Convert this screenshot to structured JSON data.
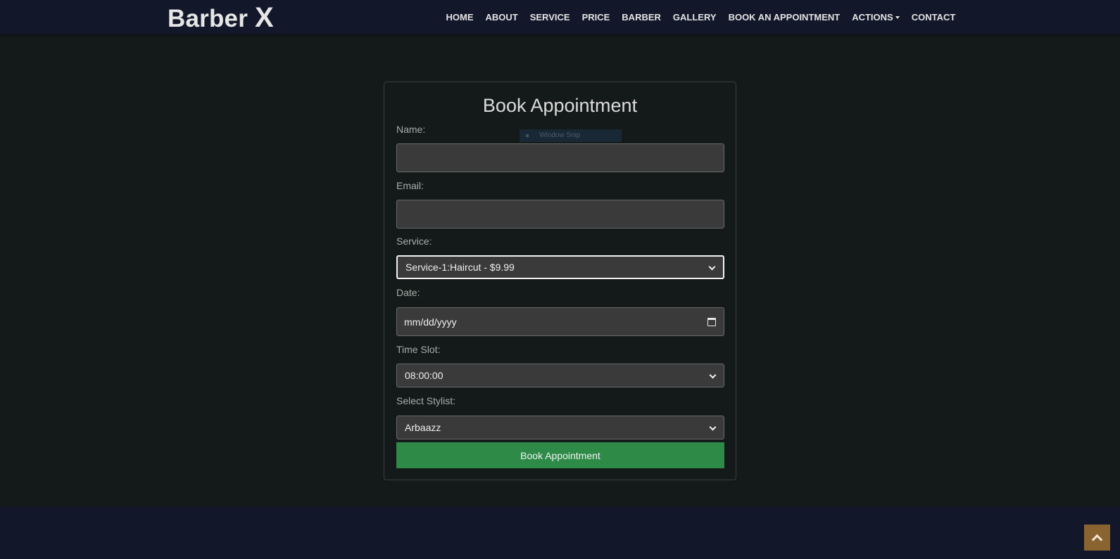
{
  "brand": {
    "name": "Barber",
    "mark": "X"
  },
  "nav": {
    "items": [
      "HOME",
      "ABOUT",
      "SERVICE",
      "PRICE",
      "BARBER",
      "GALLERY",
      "BOOK AN APPOINTMENT",
      "ACTIONS",
      "CONTACT"
    ]
  },
  "form": {
    "title": "Book Appointment",
    "name_label": "Name:",
    "name_value": "",
    "email_label": "Email:",
    "email_value": "",
    "service_label": "Service:",
    "service_value": "Service-1:Haircut - $9.99",
    "date_label": "Date:",
    "date_placeholder": "mm/dd/yyyy",
    "time_label": "Time Slot:",
    "time_value": "08:00:00",
    "stylist_label": "Select Stylist:",
    "stylist_value": "Arbaazz",
    "submit_label": "Book Appointment"
  },
  "overlay": {
    "snip_label": "Window Snip"
  },
  "colors": {
    "nav_bg": "#12172a",
    "page_bg": "#141a19",
    "button_green": "#2d8a47",
    "back_to_top": "#8a6430"
  },
  "icons": {
    "dropdown": "chevron-down-icon",
    "calendar": "calendar-icon",
    "back_to_top": "chevron-up-icon"
  }
}
